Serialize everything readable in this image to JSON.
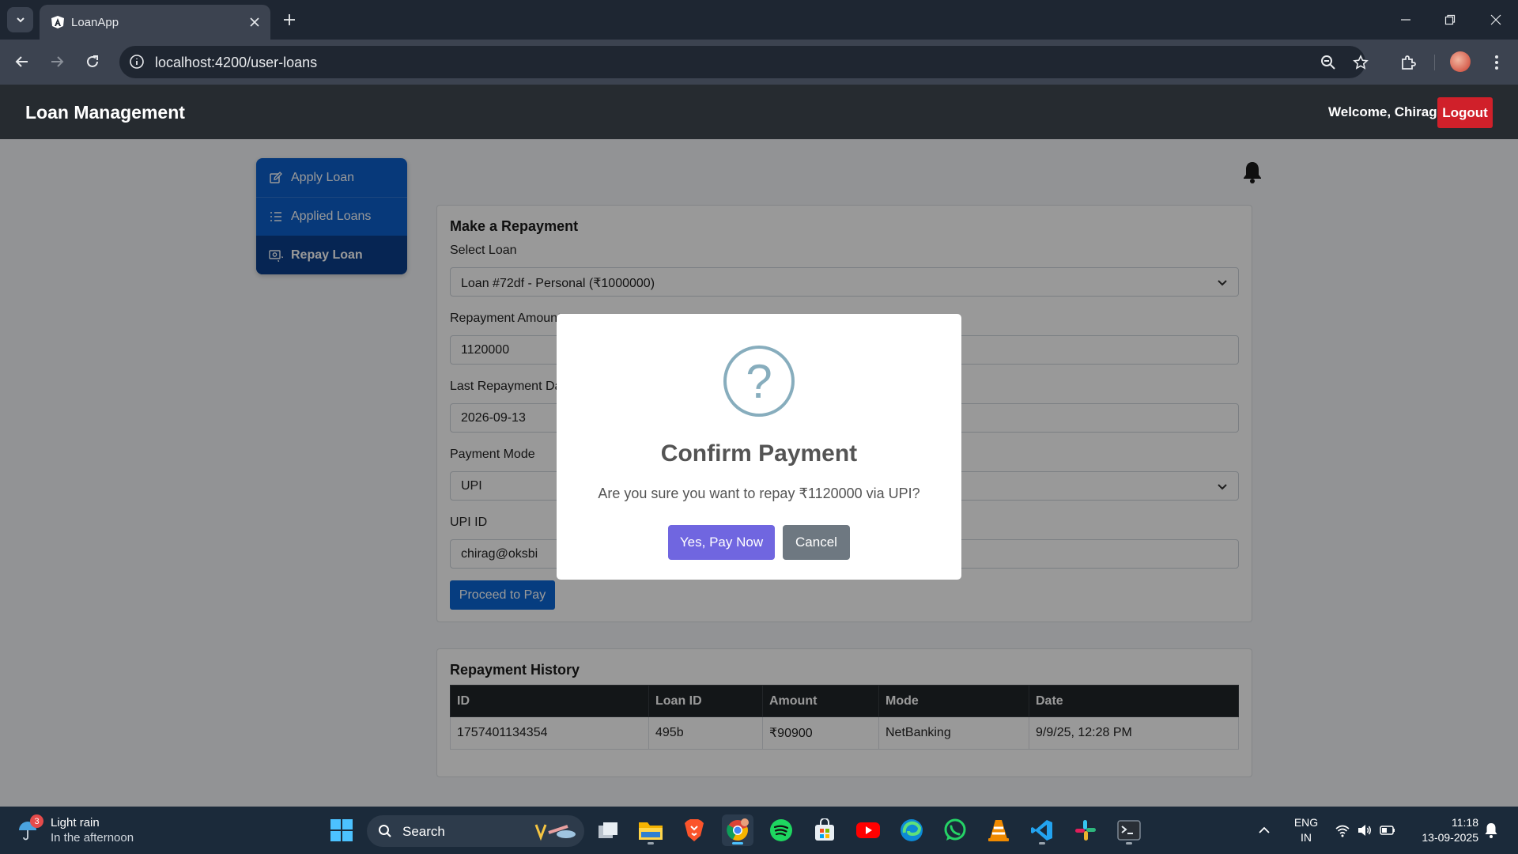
{
  "browser": {
    "tab_title": "LoanApp",
    "url": "localhost:4200/user-loans"
  },
  "navbar": {
    "brand": "Loan Management",
    "welcome": "Welcome, Chirag",
    "logout_label": "Logout"
  },
  "sidebar": {
    "items": [
      {
        "label": "Apply Loan",
        "icon": "edit-icon",
        "active": false
      },
      {
        "label": "Applied Loans",
        "icon": "list-icon",
        "active": false
      },
      {
        "label": "Repay Loan",
        "icon": "repay-icon",
        "active": true
      }
    ]
  },
  "repayment_form": {
    "title": "Make a Repayment",
    "select_loan_label": "Select Loan",
    "select_loan_value": "Loan #72df - Personal (₹1000000)",
    "amount_label": "Repayment Amount",
    "amount_value": "1120000",
    "last_date_label": "Last Repayment Date",
    "last_date_value": "2026-09-13",
    "mode_label": "Payment Mode",
    "mode_value": "UPI",
    "upi_label": "UPI ID",
    "upi_value": "chirag@oksbi",
    "proceed_label": "Proceed to Pay"
  },
  "history": {
    "title": "Repayment History",
    "columns": [
      "ID",
      "Loan ID",
      "Amount",
      "Mode",
      "Date"
    ],
    "rows": [
      [
        "1757401134354",
        "495b",
        "₹90900",
        "NetBanking",
        "9/9/25, 12:28 PM"
      ]
    ]
  },
  "modal": {
    "icon": "question-icon",
    "title": "Confirm Payment",
    "message": "Are you sure you want to repay ₹1120000 via UPI?",
    "confirm_label": "Yes, Pay Now",
    "cancel_label": "Cancel",
    "confirm_color": "#7066e0",
    "cancel_color": "#6e7881"
  },
  "taskbar": {
    "weather_badge": "3",
    "weather_line1": "Light rain",
    "weather_line2": "In the afternoon",
    "search_placeholder": "Search",
    "lang_line1": "ENG",
    "lang_line2": "IN",
    "time": "11:18",
    "date": "13-09-2025"
  },
  "colors": {
    "accent": "#0d5fcc",
    "navbar": "#262b30",
    "logout": "#d0202a"
  }
}
